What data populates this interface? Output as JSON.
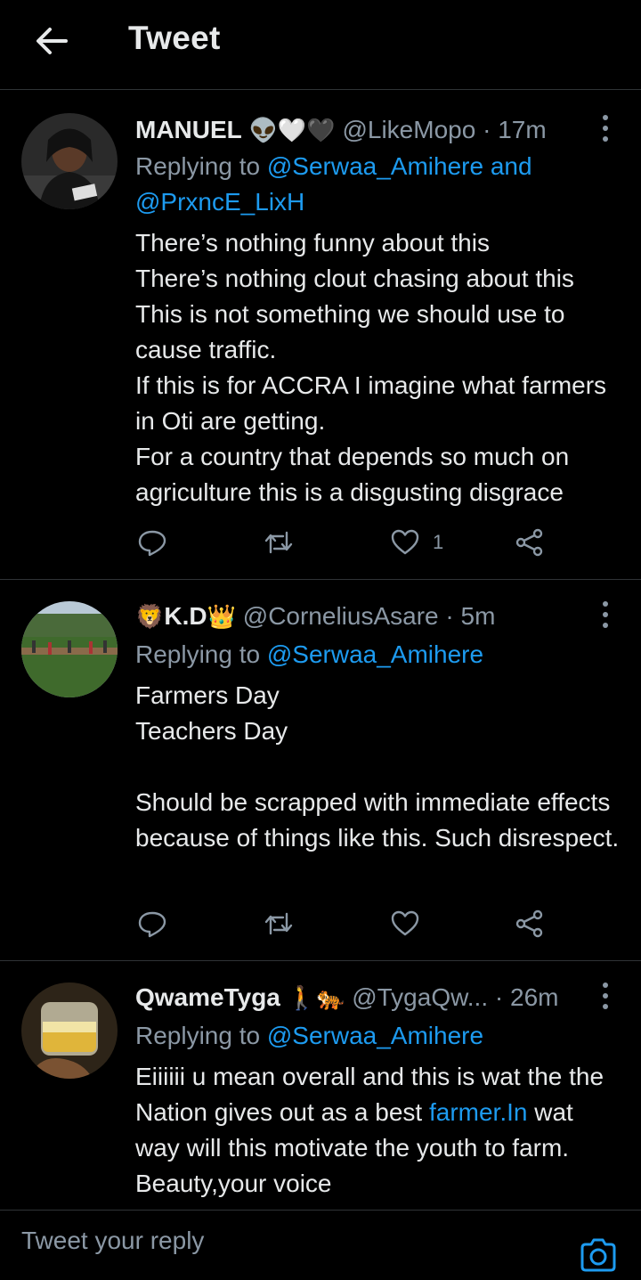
{
  "header": {
    "title": "Tweet"
  },
  "tweets": [
    {
      "name": "MANUEL",
      "name_emoji": "👽🤍🖤",
      "handle": "@LikeMopo",
      "time": "17m",
      "replying_prefix": "Replying to",
      "mention_1": "@Serwaa_Amihere",
      "mention_join": "and",
      "mention_2": "@PrxncE_LixH",
      "text": "There’s nothing funny about this\nThere’s nothing clout chasing about this\nThis is not something we should use to cause traffic.\nIf this is for ACCRA I imagine what farmers in Oti are getting.\nFor a country that depends so much on agriculture this is a disgusting disgrace",
      "like_count": "1"
    },
    {
      "name_prefix_emoji": "🦁",
      "name": "K.D",
      "name_emoji": "👑",
      "handle": "@CorneliusAsare",
      "time": "5m",
      "replying_prefix": "Replying to",
      "mention_1": "@Serwaa_Amihere",
      "text": "Farmers Day\nTeachers Day\n\nShould be scrapped with immediate effects because of things like this. Such disrespect."
    },
    {
      "name": "QwameTyga",
      "name_emoji": "🚶🐅",
      "handle": "@TygaQw...",
      "time": "26m",
      "replying_prefix": "Replying to",
      "mention_1": "@Serwaa_Amihere",
      "text_a": "Eiiiiii u mean overall and this is wat the the Nation gives out as a best ",
      "text_link": "farmer.In",
      "text_b": " wat way will this motivate the youth to farm. Beauty,your voice"
    }
  ],
  "reply_bar": {
    "placeholder": "Tweet your reply"
  },
  "icons": {
    "back": "arrow-left-icon",
    "more": "more-vertical-icon",
    "reply": "reply-icon",
    "retweet": "retweet-icon",
    "like": "heart-icon",
    "share": "share-icon",
    "camera": "camera-icon"
  },
  "colors": {
    "background": "#000000",
    "text": "#e7e9ea",
    "muted": "#8b98a5",
    "accent": "#1d9bf0",
    "divider": "#2f3336"
  }
}
